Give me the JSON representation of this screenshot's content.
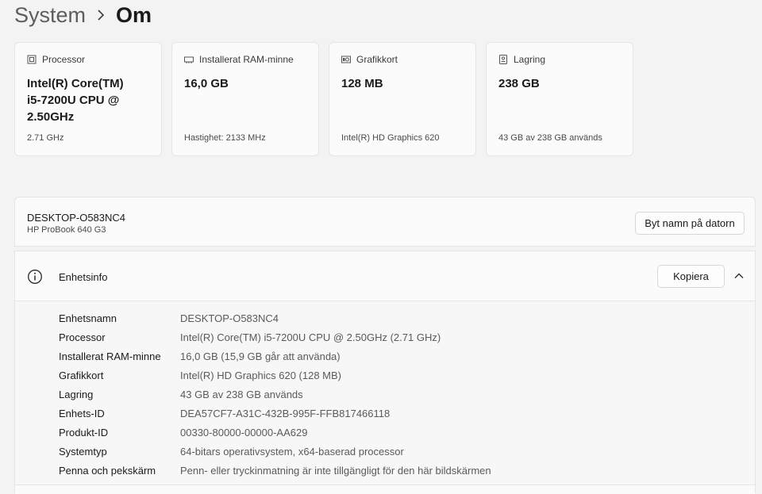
{
  "breadcrumb": {
    "parent": "System",
    "current": "Om"
  },
  "summary_cards": [
    {
      "icon": "processor-icon",
      "title": "Processor",
      "value": "Intel(R) Core(TM)\ni5-7200U CPU @\n2.50GHz",
      "sub": "2.71 GHz"
    },
    {
      "icon": "ram-icon",
      "title": "Installerat RAM-minne",
      "value": "16,0 GB",
      "sub": "Hastighet: 2133 MHz"
    },
    {
      "icon": "graphics-card-icon",
      "title": "Grafikkort",
      "value": "128 MB",
      "sub": "Intel(R) HD Graphics 620"
    },
    {
      "icon": "storage-icon",
      "title": "Lagring",
      "value": "238 GB",
      "sub": "43 GB av 238 GB används"
    }
  ],
  "device": {
    "name": "DESKTOP-O583NC4",
    "model": "HP ProBook 640 G3",
    "rename_label": "Byt namn på datorn"
  },
  "device_info": {
    "title": "Enhetsinfo",
    "copy_label": "Kopiera",
    "expanded": true,
    "rows": [
      {
        "label": "Enhetsnamn",
        "value": "DESKTOP-O583NC4"
      },
      {
        "label": "Processor",
        "value": "Intel(R) Core(TM) i5-7200U CPU @ 2.50GHz (2.71 GHz)"
      },
      {
        "label": "Installerat RAM-minne",
        "value": "16,0 GB (15,9 GB går att använda)"
      },
      {
        "label": "Grafikkort",
        "value": "Intel(R) HD Graphics 620 (128 MB)"
      },
      {
        "label": "Lagring",
        "value": "43 GB av 238 GB används"
      },
      {
        "label": "Enhets-ID",
        "value": "DEA57CF7-A31C-432B-995F-FFB817466118"
      },
      {
        "label": "Produkt-ID",
        "value": "00330-80000-00000-AA629"
      },
      {
        "label": "Systemtyp",
        "value": "64-bitars operativsystem, x64-baserad processor"
      },
      {
        "label": "Penna och pekskärm",
        "value": "Penn- eller tryckinmatning är inte tillgängligt för den här bildskärmen"
      }
    ]
  },
  "colors": {
    "background": "#f3f3f3",
    "card": "#fbfbfb",
    "border": "#e5e5e5",
    "text_primary": "#1a1a1a",
    "text_secondary": "#5a5a5a"
  }
}
